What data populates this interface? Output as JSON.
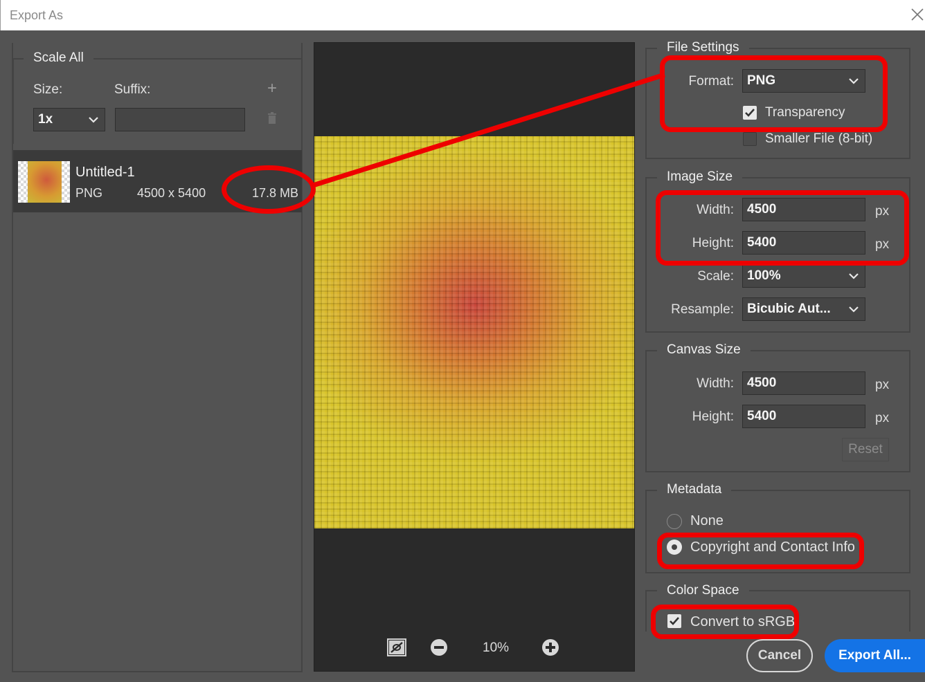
{
  "window": {
    "title": "Export As"
  },
  "scale_all": {
    "heading": "Scale All",
    "size_label": "Size:",
    "suffix_label": "Suffix:",
    "size_value": "1x",
    "suffix_value": "",
    "add_glyph": "+"
  },
  "file_item": {
    "name": "Untitled-1",
    "format": "PNG",
    "dimensions": "4500 x 5400",
    "filesize": "17.8 MB"
  },
  "preview": {
    "zoom": "10%"
  },
  "file_settings": {
    "heading": "File Settings",
    "format_label": "Format:",
    "format_value": "PNG",
    "transparency_label": "Transparency",
    "transparency_checked": true,
    "smaller_file_label": "Smaller File (8-bit)",
    "smaller_file_checked": false
  },
  "image_size": {
    "heading": "Image Size",
    "width_label": "Width:",
    "width_value": "4500",
    "height_label": "Height:",
    "height_value": "5400",
    "unit": "px",
    "scale_label": "Scale:",
    "scale_value": "100%",
    "resample_label": "Resample:",
    "resample_value": "Bicubic Aut..."
  },
  "canvas_size": {
    "heading": "Canvas Size",
    "width_label": "Width:",
    "width_value": "4500",
    "height_label": "Height:",
    "height_value": "5400",
    "unit": "px",
    "reset_label": "Reset"
  },
  "metadata": {
    "heading": "Metadata",
    "none_label": "None",
    "copyright_label": "Copyright and Contact Info",
    "selected": "copyright"
  },
  "color_space": {
    "heading": "Color Space",
    "convert_label": "Convert to sRGB",
    "convert_checked": true
  },
  "buttons": {
    "cancel": "Cancel",
    "export_all": "Export All..."
  },
  "colors": {
    "annotation_red": "#ee0000",
    "accent_blue": "#1473e6",
    "panel_bg": "#535353"
  }
}
